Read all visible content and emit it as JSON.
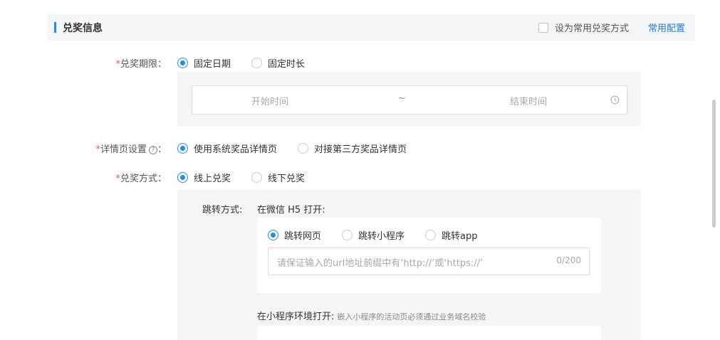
{
  "section": {
    "title": "兑奖信息",
    "set_default_label": "设为常用兑奖方式",
    "config_link": "常用配置"
  },
  "period": {
    "required": "*",
    "label": "兑奖期限：",
    "options": [
      {
        "label": "固定日期",
        "checked": true
      },
      {
        "label": "固定时长",
        "checked": false
      }
    ],
    "start_placeholder": "开始时间",
    "separator": "~",
    "end_placeholder": "结束时间"
  },
  "detail": {
    "required": "*",
    "label": "详情页设置",
    "help": "?",
    "colon": "：",
    "options": [
      {
        "label": "使用系统奖品详情页",
        "checked": true
      },
      {
        "label": "对接第三方奖品详情页",
        "checked": false
      }
    ]
  },
  "method": {
    "required": "*",
    "label": "兑奖方式：",
    "options": [
      {
        "label": "线上兑奖",
        "checked": true
      },
      {
        "label": "线下兑奖",
        "checked": false
      }
    ]
  },
  "jump": {
    "label": "跳转方式:",
    "wechat_desc": "在微信 H5 打开:",
    "options": [
      {
        "label": "跳转网页",
        "checked": true
      },
      {
        "label": "跳转小程序",
        "checked": false
      },
      {
        "label": "跳转app",
        "checked": false
      }
    ],
    "url_placeholder": "请保证输入的url地址前缀中有‘http://’或‘https://’",
    "url_count": "0/200",
    "mini_title": "在小程序环境打开:",
    "mini_hint": "嵌入小程序的活动页必须通过业务域名校验"
  },
  "colors": {
    "accent": "#1f8cf0",
    "required": "#f25555",
    "panel_bg": "#f4f5f7"
  }
}
